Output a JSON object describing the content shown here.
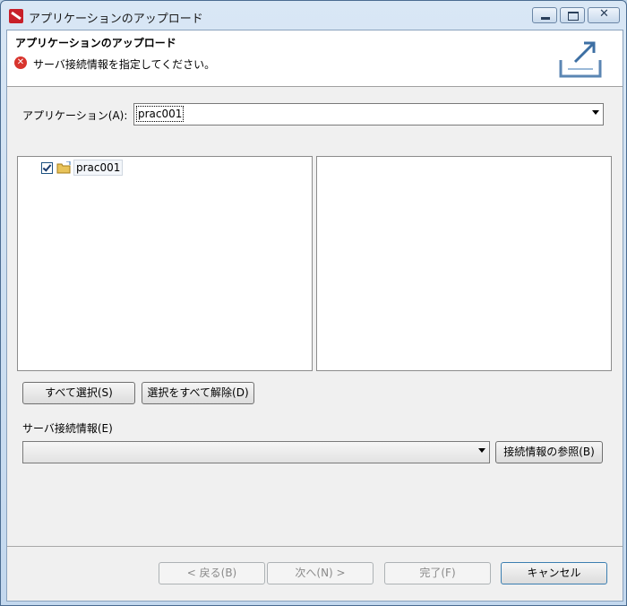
{
  "window": {
    "title": "アプリケーションのアップロード"
  },
  "banner": {
    "title": "アプリケーションのアップロード",
    "message": "サーバ接続情報を指定してください。"
  },
  "application": {
    "label": "アプリケーション(A):",
    "selected": "prac001"
  },
  "tree": {
    "items": [
      {
        "label": "prac001",
        "checked": true
      }
    ]
  },
  "buttons": {
    "select_all": "すべて選択(S)",
    "deselect_all": "選択をすべて解除(D)",
    "browse_connection": "接続情報の参照(B)",
    "back": "< 戻る(B)",
    "next": "次へ(N) >",
    "finish": "完了(F)",
    "cancel": "キャンセル"
  },
  "server": {
    "label": "サーバ接続情報(E)",
    "selected": ""
  }
}
